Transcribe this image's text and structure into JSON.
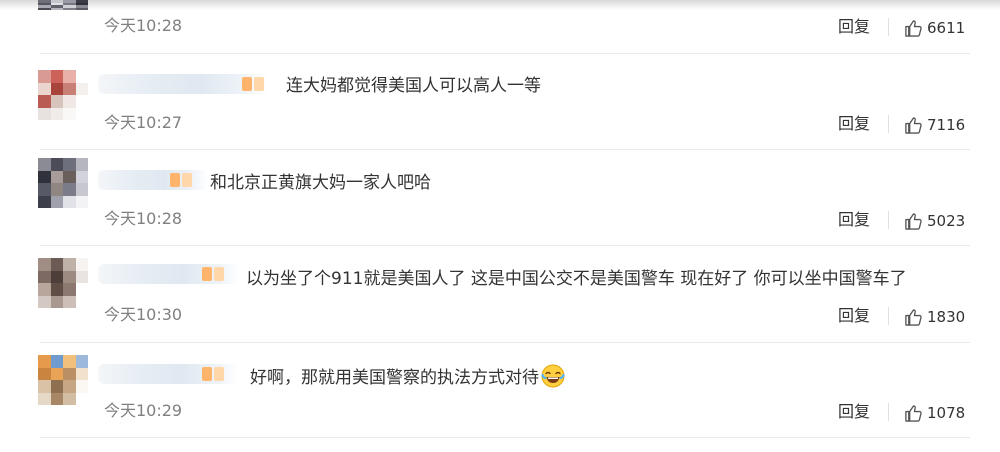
{
  "comments": [
    {
      "text": "",
      "time": "今天10:28",
      "reply_label": "回复",
      "likes": "6611",
      "avatar_colors": [
        "#6f6f7a",
        "#c7c7ce",
        "#9a9aa6",
        "#3b3b46",
        "#555562",
        "#e1e1e6",
        "#77777f",
        "#2f2f36",
        "#a9a9b2",
        "#61616b",
        "#d0d0d6",
        "#8a8a94",
        "#4a4a54",
        "#b7b7be",
        "#7d7d87",
        "#5b5b66"
      ]
    },
    {
      "text": "连大妈都觉得美国人可以高人一等",
      "time": "今天10:27",
      "reply_label": "回复",
      "likes": "7116",
      "avatar_colors": [
        "#d99a93",
        "#cd625a",
        "#e8b0a8",
        "#ffffff",
        "#ead6cf",
        "#a8443b",
        "#c88076",
        "#f3f0ee",
        "#b95b52",
        "#d6c4bd",
        "#efe8e4",
        "#ffffff",
        "#e7e2df",
        "#f1ecea",
        "#faf8f7",
        "#ffffff"
      ]
    },
    {
      "text": "和北京正黄旗大妈一家人吧哈",
      "time": "今天10:28",
      "reply_label": "回复",
      "likes": "5023",
      "avatar_colors": [
        "#8a8b95",
        "#4b4c58",
        "#6e6f7c",
        "#b5b6c0",
        "#2f313b",
        "#a79c97",
        "#6a5f5b",
        "#d2d3da",
        "#575967",
        "#8f8682",
        "#7a7c89",
        "#c7c8cf",
        "#3d3f4a",
        "#9fa0ab",
        "#e1e2e7",
        "#f3f3f5"
      ]
    },
    {
      "text": "以为坐了个911就是美国人了 这是中国公交不是美国警车 现在好了 你可以坐中国警车了",
      "time": "今天10:30",
      "reply_label": "回复",
      "likes": "1830",
      "avatar_colors": [
        "#a08e84",
        "#6c5b54",
        "#bfb0a8",
        "#f6f3f1",
        "#7d6a62",
        "#4e3f3a",
        "#9d8a80",
        "#e9e4e1",
        "#b8a59c",
        "#5f4d46",
        "#8c7870",
        "#ffffff",
        "#d3c8c2",
        "#a89890",
        "#cdbfb8",
        "#ffffff"
      ]
    },
    {
      "text": "好啊，那就用美国警察的执法方式对待",
      "time": "今天10:29",
      "reply_label": "回复",
      "likes": "1078",
      "avatar_colors": [
        "#e59a4c",
        "#6f9bcf",
        "#f0c07c",
        "#9cb9db",
        "#c9853f",
        "#e8a356",
        "#b98f63",
        "#f2e1cc",
        "#d9c2a6",
        "#8e6f50",
        "#c7a684",
        "#fbf7f2",
        "#e6d8c7",
        "#a88767",
        "#d3bda3",
        "#ffffff"
      ]
    }
  ],
  "icons": {
    "like": "thumbs-up-icon",
    "emoji": "laughing-tears-emoji-icon"
  },
  "colors": {
    "time": "#808080",
    "text": "#333333",
    "divider": "#e9e9e9",
    "blur_accent": "#ffb36b"
  }
}
